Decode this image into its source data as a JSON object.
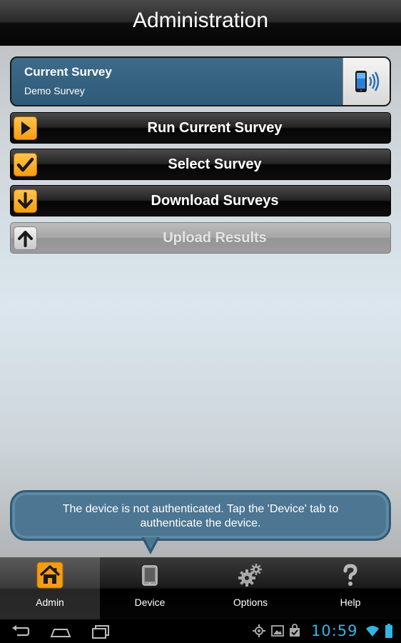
{
  "header": {
    "title": "Administration"
  },
  "current_survey": {
    "title": "Current Survey",
    "name": "Demo Survey",
    "icon": "phone-sync-icon"
  },
  "actions": [
    {
      "label": "Run Current Survey",
      "icon": "play-icon",
      "enabled": true
    },
    {
      "label": "Select Survey",
      "icon": "checkmark-icon",
      "enabled": true
    },
    {
      "label": "Download Surveys",
      "icon": "arrow-down-icon",
      "enabled": true
    },
    {
      "label": "Upload Results",
      "icon": "arrow-up-icon",
      "enabled": false
    }
  ],
  "notice": {
    "text": "The device is not authenticated. Tap the 'Device' tab to authenticate the device."
  },
  "tabs": [
    {
      "label": "Admin",
      "icon": "home-icon",
      "active": true
    },
    {
      "label": "Device",
      "icon": "tablet-icon",
      "active": false
    },
    {
      "label": "Options",
      "icon": "gears-icon",
      "active": false
    },
    {
      "label": "Help",
      "icon": "question-icon",
      "active": false
    }
  ],
  "status_bar": {
    "time": "10:59",
    "icons": [
      "gps-icon",
      "image-icon",
      "shopping-bag-icon",
      "wifi-icon",
      "battery-icon"
    ]
  },
  "colors": {
    "accent_orange": "#f59d12",
    "panel_blue": "#2f5a78",
    "clock_blue": "#33b5e5"
  }
}
